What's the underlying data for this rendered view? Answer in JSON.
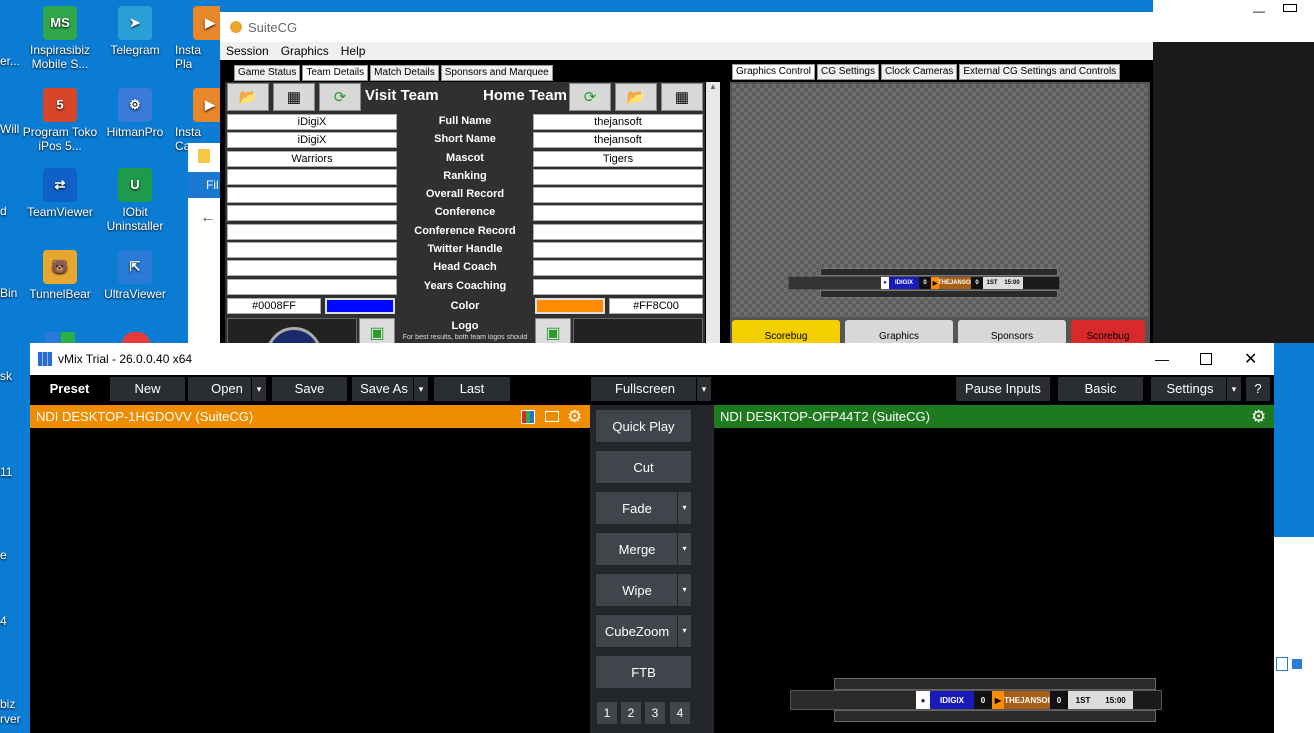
{
  "desktop": {
    "icons": [
      {
        "label": "Inspirasibiz Mobile S...",
        "abbr": "MS",
        "color": "#2ea84a"
      },
      {
        "label": "Telegram",
        "abbr": "➤",
        "color": "#2aa0d8"
      },
      {
        "label": "Insta Pla",
        "abbr": "▶",
        "color": "#e8862a"
      },
      {
        "label": "Program Toko iPos 5...",
        "abbr": "5",
        "color": "#d8462a"
      },
      {
        "label": "HitmanPro",
        "abbr": "⚙",
        "color": "#3a7ad8"
      },
      {
        "label": "Insta Cap",
        "abbr": "▶",
        "color": "#e8862a"
      },
      {
        "label": "TeamViewer",
        "abbr": "⇄",
        "color": "#0e5fc8"
      },
      {
        "label": "IObit Uninstaller",
        "abbr": "U",
        "color": "#1e9b4a"
      },
      {
        "label": "TunnelBear",
        "abbr": "🐻",
        "color": "#e8a830"
      },
      {
        "label": "UltraViewer",
        "abbr": "⇱",
        "color": "#2a7ad8"
      }
    ],
    "edge_labels": [
      "er...",
      "Will",
      "d",
      "Bin",
      "sk",
      "11",
      "e",
      "4",
      "biz",
      "rver"
    ],
    "explorer_partial": {
      "label": "Fil"
    }
  },
  "suitecg": {
    "title": "SuiteCG",
    "menu": [
      "Session",
      "Graphics",
      "Help"
    ],
    "left_tabs": [
      "Game Status",
      "Team Details",
      "Match Details",
      "Sponsors and Marquee"
    ],
    "right_tabs": [
      "Graphics Control",
      "CG Settings",
      "Clock Cameras",
      "External CG Settings and Controls"
    ],
    "visit_team_label": "Visit Team",
    "home_team_label": "Home Team",
    "rows": [
      {
        "label": "Full Name",
        "visit": "iDigiX",
        "home": "thejansoft"
      },
      {
        "label": "Short Name",
        "visit": "iDigiX",
        "home": "thejansoft"
      },
      {
        "label": "Mascot",
        "visit": "Warriors",
        "home": "Tigers"
      },
      {
        "label": "Ranking",
        "visit": "",
        "home": ""
      },
      {
        "label": "Overall Record",
        "visit": "",
        "home": ""
      },
      {
        "label": "Conference",
        "visit": "",
        "home": ""
      },
      {
        "label": "Conference Record",
        "visit": "",
        "home": ""
      },
      {
        "label": "Twitter Handle",
        "visit": "",
        "home": ""
      },
      {
        "label": "Head Coach",
        "visit": "",
        "home": ""
      },
      {
        "label": "Years Coaching",
        "visit": "",
        "home": ""
      }
    ],
    "color_label": "Color",
    "visit_color_hex": "#0008FF",
    "home_color_hex": "#FF8C00",
    "visit_color": "#0008ff",
    "home_color": "#ff8c00",
    "logo_label": "Logo",
    "logo_hint": "For best results, both team logos should",
    "cg_buttons": [
      {
        "label": "Scorebug",
        "color": "#f5d000"
      },
      {
        "label": "Graphics",
        "color": "#d8d8d8"
      },
      {
        "label": "Sponsors",
        "color": "#d8d8d8"
      },
      {
        "label": "Scorebug",
        "color": "#d82a2a"
      }
    ]
  },
  "scorebug": {
    "visit": "IDIGIX",
    "visit_score": "0",
    "home": "THEJANSOI",
    "home_score": "0",
    "period": "1ST",
    "clock": "15:00"
  },
  "vmix": {
    "title": "vMix Trial - 26.0.0.40 x64",
    "toolbar": {
      "preset": "Preset",
      "new": "New",
      "open": "Open",
      "save": "Save",
      "save_as": "Save As",
      "last": "Last",
      "fullscreen": "Fullscreen",
      "pause_inputs": "Pause Inputs",
      "basic": "Basic",
      "settings": "Settings",
      "help": "?"
    },
    "preview_title": "NDI DESKTOP-1HGDOVV (SuiteCG)",
    "output_title": "NDI DESKTOP-OFP44T2 (SuiteCG)",
    "transitions": [
      "Quick Play",
      "Cut",
      "Fade",
      "Merge",
      "Wipe",
      "CubeZoom",
      "FTB"
    ],
    "transition_numbers": [
      "1",
      "2",
      "3",
      "4"
    ],
    "preview_header_color": "#f08c00",
    "output_header_color": "#1e7a1e"
  }
}
